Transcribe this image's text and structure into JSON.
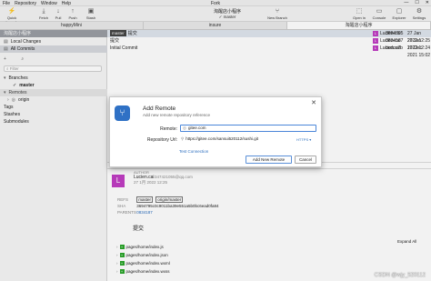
{
  "window": {
    "title": "Fork",
    "menu": [
      "File",
      "Repository",
      "Window",
      "Help"
    ],
    "controls": [
      "—",
      "☐",
      "✕"
    ]
  },
  "toolbar": {
    "buttons": [
      {
        "label": "Quick Launch",
        "icon": "rocket-icon",
        "glyph": "⚡"
      },
      {
        "label": "Fetch",
        "icon": "fetch-icon",
        "glyph": "⤓"
      },
      {
        "label": "Pull",
        "icon": "pull-icon",
        "glyph": "↓"
      },
      {
        "label": "Push",
        "icon": "push-icon",
        "glyph": "↑"
      },
      {
        "label": "Stash",
        "icon": "stash-icon",
        "glyph": "▣"
      },
      {
        "label": "New Branch",
        "icon": "branch-icon",
        "glyph": "⑂"
      },
      {
        "label": "Open in",
        "icon": "open-in-icon",
        "glyph": "⬚"
      },
      {
        "label": "Console",
        "icon": "console-icon",
        "glyph": "▭"
      },
      {
        "label": "Explorer",
        "icon": "folder-icon",
        "glyph": "▢"
      },
      {
        "label": "Settings",
        "icon": "gear-icon",
        "glyph": "⚙"
      }
    ],
    "repo_name": "淘醒店小程序",
    "repo_branch": "✓ master"
  },
  "repo_tabs": [
    "happyMini",
    "insure",
    "淘醒店小程序"
  ],
  "sidebar": {
    "repo_title": "淘醒店小程序",
    "local_changes": "Local Changes",
    "all_commits": "All Commits",
    "filter_placeholder": "Filter",
    "branches_header": "Branches",
    "branch_master": "master",
    "remotes_header": "Remotes",
    "remote_origin": "origin",
    "tags": "Tags",
    "stashes": "Stashes",
    "submodules": "Submodules"
  },
  "commits": [
    {
      "tags": [
        "master"
      ],
      "message": "提交",
      "author": "Lucien.cai",
      "avatar": "L",
      "sha": "3694795",
      "date": "27 Jan 2022 12:25"
    },
    {
      "tags": [],
      "message": "提交",
      "author": "Lucien.cai",
      "avatar": "L",
      "sha": "0834187",
      "date": "27 Jan 2022 12:24"
    },
    {
      "tags": [],
      "message": "Initial Commit",
      "author": "Lucien.cai",
      "avatar": "L",
      "sha": "bcdca7b",
      "date": "17 Dec 2021 15:02"
    }
  ],
  "detail": {
    "author_label": "AUTHOR",
    "avatar": "L",
    "author_name": "Lucien.cai",
    "author_email": "347421055@qq.com",
    "author_date": "27 1月 2022 12:25",
    "refs_label": "REFS",
    "refs": [
      "master",
      "origin/master"
    ],
    "sha_label": "SHA",
    "sha_value": "3694795c0c9011ba39e551a5b0bc6ead0fa84",
    "parents_label": "PARENTS",
    "parents_value": "0834187",
    "commit_title": "提交",
    "expand_all": "Expand All",
    "files": [
      "pages/home/index.js",
      "pages/home/index.json",
      "pages/home/index.wxml",
      "pages/home/index.wxss"
    ]
  },
  "dialog": {
    "title": "Add Remote",
    "subtitle": "Add new remote repository reference",
    "remote_label": "Remote:",
    "remote_value": "gitee.com",
    "url_label": "Repository Url:",
    "url_value": "https://gitee.com/sansui520112/sushi.git",
    "url_kind": "HTTPS ▾",
    "test_connection": "Test Connection",
    "add_button": "Add New Remote",
    "cancel_button": "Cancel"
  },
  "watermark": "CSDN @wjy_520112"
}
